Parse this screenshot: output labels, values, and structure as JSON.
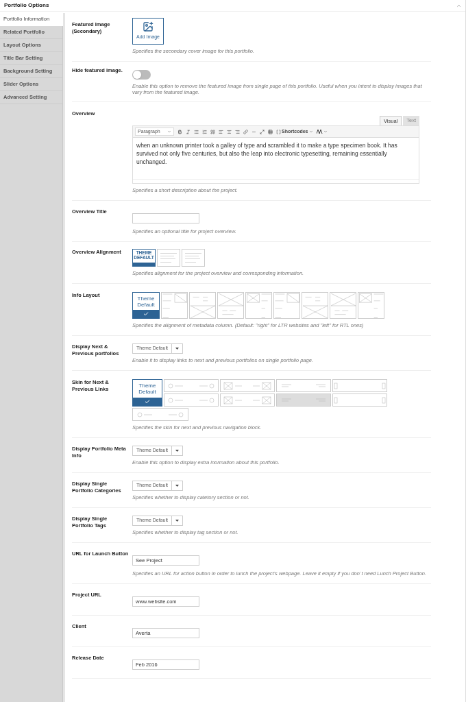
{
  "panel": {
    "title": "Portfolio Options",
    "expanded": true
  },
  "tabs": [
    {
      "label": "Portfolio Information",
      "selected": true
    },
    {
      "label": "Related Portfolio",
      "selected": false
    },
    {
      "label": "Layout Options",
      "selected": false
    },
    {
      "label": "Title Bar Setting",
      "selected": false
    },
    {
      "label": "Background Setting",
      "selected": false
    },
    {
      "label": "Slider Options",
      "selected": false
    },
    {
      "label": "Advanced Setting",
      "selected": false
    }
  ],
  "fields": [
    {
      "kind": "image",
      "label": "Featured Image (Secondary)",
      "button": "Add Image",
      "description": "Specifies the secondary cover image for this portfolio."
    },
    {
      "kind": "toggle",
      "label": "Hide featured image.",
      "on": false,
      "description": "Enable this option to remove the featured image from single page of this portfolio. Useful when you intent to display images that vary from the featured image."
    },
    {
      "kind": "editor",
      "label": "Overview",
      "tabs": [
        {
          "label": "Visual",
          "selected": true
        },
        {
          "label": "Text",
          "selected": false
        }
      ],
      "format": "Paragraph",
      "shortcodes": "Shortcodes",
      "value": "when an unknown printer took a galley of type and scrambled it to make a type specimen book. It has survived not only five centuries, but also the leap into electronic typesetting, remaining essentially unchanged.",
      "description": "Specifies a short description about the project."
    },
    {
      "kind": "text",
      "label": "Overview Title",
      "description": "Specifies an optional title for project overview."
    },
    {
      "kind": "alignment",
      "label": "Overview Alignment",
      "options": [
        {
          "label": "THEME DEFAULT",
          "selected": true
        },
        {
          "selected": false
        },
        {
          "selected": false
        }
      ],
      "description": "Specifies alignment for the project overview and corresponding information."
    },
    {
      "kind": "layout",
      "label": "Info Layout",
      "options": [
        {
          "label": "Theme Default",
          "selected": true
        },
        {
          "selected": false
        },
        {
          "selected": false
        },
        {
          "selected": false
        },
        {
          "selected": false
        },
        {
          "selected": false
        },
        {
          "selected": false
        },
        {
          "selected": false
        },
        {
          "selected": false
        }
      ],
      "description": "Specifies the alignment of metadata column. (Default: \"right\" for LTR websites and \"left\" for RTL ones)"
    },
    {
      "kind": "select",
      "label": "Display Next & Previous portfolios",
      "value": "Theme Default",
      "description": "Enable it to display links to next and previous portfolios on single portfolio page."
    },
    {
      "kind": "skin",
      "label": "Skin for Next & Previous Links",
      "options": [
        {
          "label": "Theme Default",
          "selected": true
        },
        {
          "selected": false
        },
        {
          "selected": false
        },
        {
          "selected": false
        },
        {
          "selected": false
        },
        {
          "selected": false
        },
        {
          "selected": false
        },
        {
          "selected": false
        },
        {
          "selected": false
        },
        {
          "selected": false
        }
      ],
      "description": "Specifies the skin for next and previous navigation block."
    },
    {
      "kind": "select",
      "label": "Display Portfolio Meta Info",
      "value": "Theme Default",
      "description": "Enable this option to display extra inormation about this portfolio."
    },
    {
      "kind": "select",
      "label": "Display Single Portfolio Categories",
      "value": "Theme Default",
      "description": "Specifies whether to display catetory section or not."
    },
    {
      "kind": "select",
      "label": "Display Single Portfolio Tags",
      "value": "Theme Default",
      "description": "Specifies whether to display tag section or not."
    },
    {
      "kind": "text",
      "label": "URL for Launch Button",
      "value": "See Project",
      "description": "Specifies an URL for action button in order to lunch the project's webpage. Leave it empty if you don`t need Lunch Project Button."
    },
    {
      "kind": "text",
      "label": "Project URL",
      "value": "www.website.com"
    },
    {
      "kind": "text",
      "label": "Client",
      "value": "Averta"
    },
    {
      "kind": "text",
      "label": "Release Date",
      "value": "Feb 2016"
    }
  ]
}
